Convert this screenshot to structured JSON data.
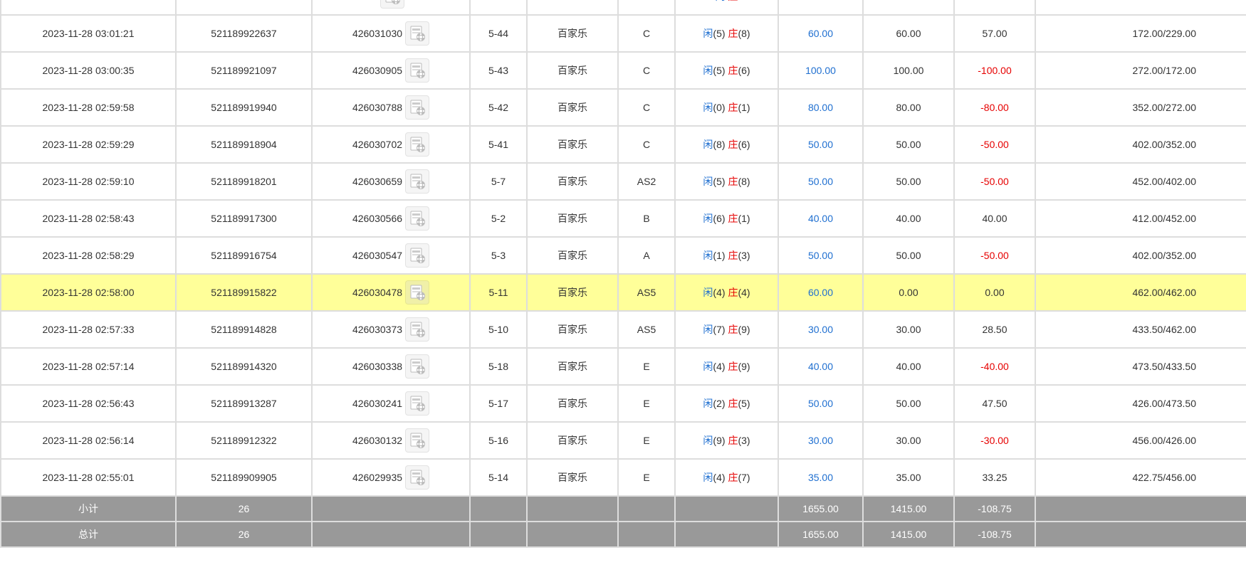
{
  "rows": [
    {
      "time": "",
      "order": "",
      "round": "",
      "shoe": "",
      "game": "",
      "table": "",
      "result": {
        "xian_label": "闲",
        "xian_val": "",
        "zhuang_label": "庄",
        "zhuang_val": ""
      },
      "bet": "",
      "valid": "",
      "winloss": "",
      "winloss_neg": false,
      "balance": "",
      "highlight": false
    },
    {
      "time": "2023-11-28 03:01:21",
      "order": "521189922637",
      "round": "426031030",
      "shoe": "5-44",
      "game": "百家乐",
      "table": "C",
      "result": {
        "xian_label": "闲",
        "xian_val": "(5)",
        "zhuang_label": "庄",
        "zhuang_val": "(8)"
      },
      "bet": "60.00",
      "valid": "60.00",
      "winloss": "57.00",
      "winloss_neg": false,
      "balance": "172.00/229.00",
      "highlight": false
    },
    {
      "time": "2023-11-28 03:00:35",
      "order": "521189921097",
      "round": "426030905",
      "shoe": "5-43",
      "game": "百家乐",
      "table": "C",
      "result": {
        "xian_label": "闲",
        "xian_val": "(5)",
        "zhuang_label": "庄",
        "zhuang_val": "(6)"
      },
      "bet": "100.00",
      "valid": "100.00",
      "winloss": "-100.00",
      "winloss_neg": true,
      "balance": "272.00/172.00",
      "highlight": false
    },
    {
      "time": "2023-11-28 02:59:58",
      "order": "521189919940",
      "round": "426030788",
      "shoe": "5-42",
      "game": "百家乐",
      "table": "C",
      "result": {
        "xian_label": "闲",
        "xian_val": "(0)",
        "zhuang_label": "庄",
        "zhuang_val": "(1)"
      },
      "bet": "80.00",
      "valid": "80.00",
      "winloss": "-80.00",
      "winloss_neg": true,
      "balance": "352.00/272.00",
      "highlight": false
    },
    {
      "time": "2023-11-28 02:59:29",
      "order": "521189918904",
      "round": "426030702",
      "shoe": "5-41",
      "game": "百家乐",
      "table": "C",
      "result": {
        "xian_label": "闲",
        "xian_val": "(8)",
        "zhuang_label": "庄",
        "zhuang_val": "(6)"
      },
      "bet": "50.00",
      "valid": "50.00",
      "winloss": "-50.00",
      "winloss_neg": true,
      "balance": "402.00/352.00",
      "highlight": false
    },
    {
      "time": "2023-11-28 02:59:10",
      "order": "521189918201",
      "round": "426030659",
      "shoe": "5-7",
      "game": "百家乐",
      "table": "AS2",
      "result": {
        "xian_label": "闲",
        "xian_val": "(5)",
        "zhuang_label": "庄",
        "zhuang_val": "(8)"
      },
      "bet": "50.00",
      "valid": "50.00",
      "winloss": "-50.00",
      "winloss_neg": true,
      "balance": "452.00/402.00",
      "highlight": false
    },
    {
      "time": "2023-11-28 02:58:43",
      "order": "521189917300",
      "round": "426030566",
      "shoe": "5-2",
      "game": "百家乐",
      "table": "B",
      "result": {
        "xian_label": "闲",
        "xian_val": "(6)",
        "zhuang_label": "庄",
        "zhuang_val": "(1)"
      },
      "bet": "40.00",
      "valid": "40.00",
      "winloss": "40.00",
      "winloss_neg": false,
      "balance": "412.00/452.00",
      "highlight": false
    },
    {
      "time": "2023-11-28 02:58:29",
      "order": "521189916754",
      "round": "426030547",
      "shoe": "5-3",
      "game": "百家乐",
      "table": "A",
      "result": {
        "xian_label": "闲",
        "xian_val": "(1)",
        "zhuang_label": "庄",
        "zhuang_val": "(3)"
      },
      "bet": "50.00",
      "valid": "50.00",
      "winloss": "-50.00",
      "winloss_neg": true,
      "balance": "402.00/352.00",
      "highlight": false
    },
    {
      "time": "2023-11-28 02:58:00",
      "order": "521189915822",
      "round": "426030478",
      "shoe": "5-11",
      "game": "百家乐",
      "table": "AS5",
      "result": {
        "xian_label": "闲",
        "xian_val": "(4)",
        "zhuang_label": "庄",
        "zhuang_val": "(4)"
      },
      "bet": "60.00",
      "valid": "0.00",
      "winloss": "0.00",
      "winloss_neg": false,
      "balance": "462.00/462.00",
      "highlight": true
    },
    {
      "time": "2023-11-28 02:57:33",
      "order": "521189914828",
      "round": "426030373",
      "shoe": "5-10",
      "game": "百家乐",
      "table": "AS5",
      "result": {
        "xian_label": "闲",
        "xian_val": "(7)",
        "zhuang_label": "庄",
        "zhuang_val": "(9)"
      },
      "bet": "30.00",
      "valid": "30.00",
      "winloss": "28.50",
      "winloss_neg": false,
      "balance": "433.50/462.00",
      "highlight": false
    },
    {
      "time": "2023-11-28 02:57:14",
      "order": "521189914320",
      "round": "426030338",
      "shoe": "5-18",
      "game": "百家乐",
      "table": "E",
      "result": {
        "xian_label": "闲",
        "xian_val": "(4)",
        "zhuang_label": "庄",
        "zhuang_val": "(9)"
      },
      "bet": "40.00",
      "valid": "40.00",
      "winloss": "-40.00",
      "winloss_neg": true,
      "balance": "473.50/433.50",
      "highlight": false
    },
    {
      "time": "2023-11-28 02:56:43",
      "order": "521189913287",
      "round": "426030241",
      "shoe": "5-17",
      "game": "百家乐",
      "table": "E",
      "result": {
        "xian_label": "闲",
        "xian_val": "(2)",
        "zhuang_label": "庄",
        "zhuang_val": "(5)"
      },
      "bet": "50.00",
      "valid": "50.00",
      "winloss": "47.50",
      "winloss_neg": false,
      "balance": "426.00/473.50",
      "highlight": false
    },
    {
      "time": "2023-11-28 02:56:14",
      "order": "521189912322",
      "round": "426030132",
      "shoe": "5-16",
      "game": "百家乐",
      "table": "E",
      "result": {
        "xian_label": "闲",
        "xian_val": "(9)",
        "zhuang_label": "庄",
        "zhuang_val": "(3)"
      },
      "bet": "30.00",
      "valid": "30.00",
      "winloss": "-30.00",
      "winloss_neg": true,
      "balance": "456.00/426.00",
      "highlight": false
    },
    {
      "time": "2023-11-28 02:55:01",
      "order": "521189909905",
      "round": "426029935",
      "shoe": "5-14",
      "game": "百家乐",
      "table": "E",
      "result": {
        "xian_label": "闲",
        "xian_val": "(4)",
        "zhuang_label": "庄",
        "zhuang_val": "(7)"
      },
      "bet": "35.00",
      "valid": "35.00",
      "winloss": "33.25",
      "winloss_neg": false,
      "balance": "422.75/456.00",
      "highlight": false
    }
  ],
  "subtotal": {
    "label": "小计",
    "count": "26",
    "bet": "1655.00",
    "valid": "1415.00",
    "winloss": "-108.75"
  },
  "total": {
    "label": "总计",
    "count": "26",
    "bet": "1655.00",
    "valid": "1415.00",
    "winloss": "-108.75"
  },
  "icons": {
    "video": "video-replay-icon"
  },
  "colors": {
    "blue": "#1f6fd0",
    "red": "#e60000",
    "highlight": "#ffff99",
    "summary_bg": "#999999"
  }
}
